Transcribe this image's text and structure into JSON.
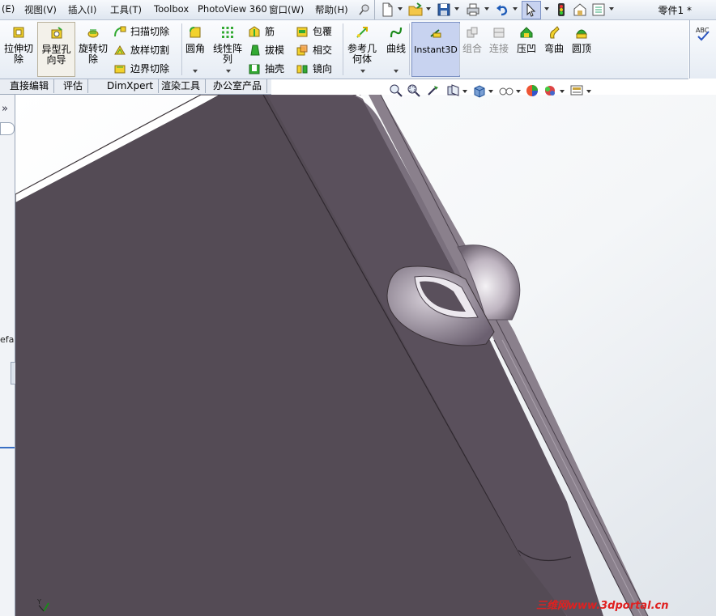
{
  "menubar": {
    "items": [
      "(E)",
      "视图(V)",
      "插入(I)",
      "工具(T)",
      "Toolbox",
      "PhotoView 360",
      "窗口(W)",
      "帮助(H)"
    ],
    "document_title": "零件1 *"
  },
  "features": {
    "extrude_cut": "拉伸切\n除",
    "hole_wizard": "异型孔\n向导",
    "revolve_cut": "旋转切\n除",
    "sweep_cut": "扫描切除",
    "loft_cut": "放样切割",
    "boundary_cut": "边界切除",
    "fillet": "圆角",
    "linear_pattern": "线性阵\n列",
    "rib": "筋",
    "draft": "拔模",
    "shell": "抽壳",
    "wrap": "包覆",
    "intersect": "相交",
    "mirror": "镜向",
    "ref_geometry": "参考几\n何体",
    "curves": "曲线",
    "instant3d": "Instant3D",
    "combine": "组合",
    "join": "连接",
    "indent": "压凹",
    "flex": "弯曲",
    "dome": "圆顶"
  },
  "tabs": [
    "直接编辑",
    "评估",
    "DimXpert",
    "渲染工具",
    "办公室产品"
  ],
  "left_panel": {
    "expand": "»",
    "partial_text": "efa"
  },
  "watermark": "三维网www.3dportal.cn",
  "colors": {
    "accent": "#c8d3f0",
    "model_dark": "#544b55",
    "model_light": "#8a808c"
  }
}
